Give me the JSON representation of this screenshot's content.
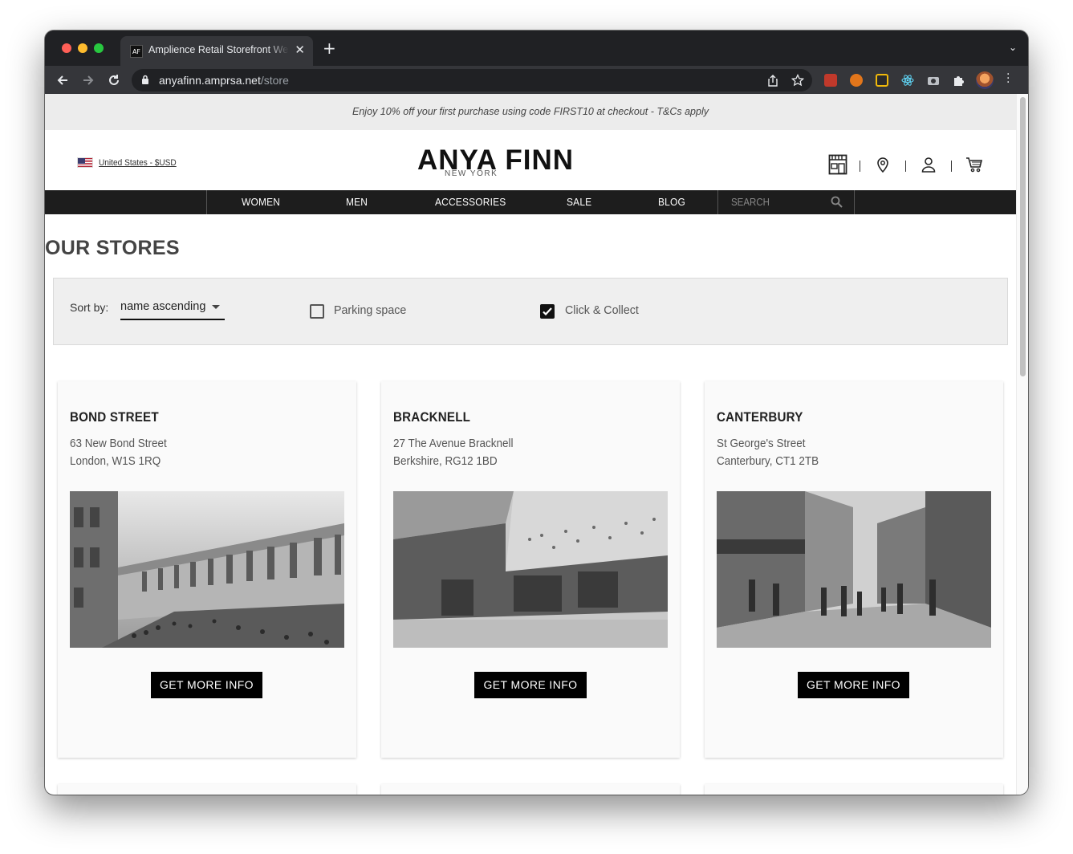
{
  "browser": {
    "tab_title": "Amplience Retail Storefront Web",
    "tab_favicon": "AF",
    "url_host": "anyafinn.amprsa.net",
    "url_path": "/store"
  },
  "promo": {
    "text": "Enjoy 10% off your first purchase using code FIRST10 at checkout - T&Cs apply"
  },
  "header": {
    "locale": "United States - $USD",
    "logo_main": "ANYA FINN",
    "logo_sub": "NEW YORK",
    "icons": [
      "store-icon",
      "location-pin-icon",
      "account-icon",
      "cart-icon"
    ]
  },
  "nav": {
    "items": [
      "WOMEN",
      "MEN",
      "ACCESSORIES",
      "SALE",
      "BLOG"
    ],
    "search_placeholder": "SEARCH"
  },
  "page": {
    "title": "OUR STORES"
  },
  "filters": {
    "sort_label": "Sort by:",
    "sort_value": "name ascending",
    "parking_label": "Parking space",
    "parking_checked": false,
    "click_collect_label": "Click & Collect",
    "click_collect_checked": true
  },
  "stores": [
    {
      "name": "BOND STREET",
      "address1": "63 New Bond Street",
      "address2": "London, W1S 1RQ",
      "button": "GET MORE INFO"
    },
    {
      "name": "BRACKNELL",
      "address1": "27 The Avenue Bracknell",
      "address2": "Berkshire, RG12 1BD",
      "button": "GET MORE INFO"
    },
    {
      "name": "CANTERBURY",
      "address1": "St George's Street",
      "address2": "Canterbury, CT1 2TB",
      "button": "GET MORE INFO"
    }
  ],
  "colors": {
    "navbar": "#1d1d1d",
    "button": "#000000",
    "promo_bg": "#ececec"
  }
}
